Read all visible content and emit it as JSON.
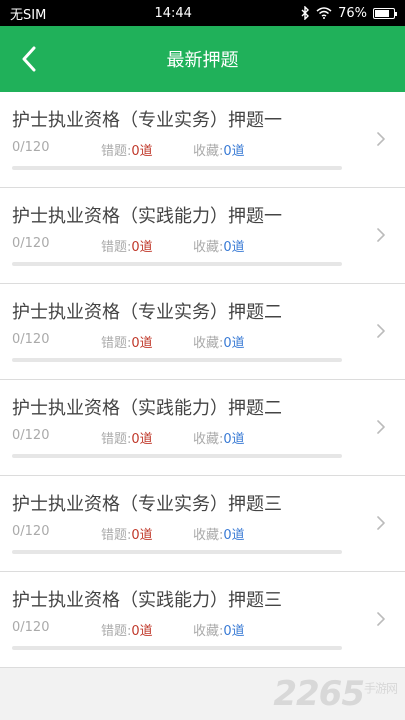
{
  "status_bar": {
    "carrier": "无SIM",
    "time": "14:44",
    "battery": "76%",
    "battery_level": 0.76
  },
  "header": {
    "title": "最新押题",
    "back_icon": "back-arrow-icon"
  },
  "labels": {
    "wrong": "错题:",
    "favorites": "收藏:"
  },
  "items": [
    {
      "title": "护士执业资格（专业实务）押题一",
      "progress": "0/120",
      "wrong": "0道",
      "favorites": "0道",
      "completion": 0
    },
    {
      "title": "护士执业资格（实践能力）押题一",
      "progress": "0/120",
      "wrong": "0道",
      "favorites": "0道",
      "completion": 0
    },
    {
      "title": "护士执业资格（专业实务）押题二",
      "progress": "0/120",
      "wrong": "0道",
      "favorites": "0道",
      "completion": 0
    },
    {
      "title": "护士执业资格（实践能力）押题二",
      "progress": "0/120",
      "wrong": "0道",
      "favorites": "0道",
      "completion": 0
    },
    {
      "title": "护士执业资格（专业实务）押题三",
      "progress": "0/120",
      "wrong": "0道",
      "favorites": "0道",
      "completion": 0
    },
    {
      "title": "护士执业资格（实践能力）押题三",
      "progress": "0/120",
      "wrong": "0道",
      "favorites": "0道",
      "completion": 0
    }
  ],
  "watermark": {
    "brand": "2265",
    "site": "手游网"
  },
  "colors": {
    "accent": "#20b15a",
    "wrong": "#c0392b",
    "favorite": "#3a7bd5"
  }
}
